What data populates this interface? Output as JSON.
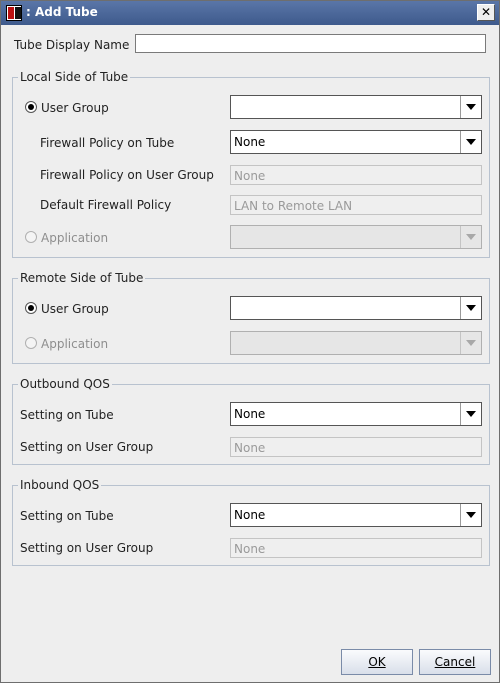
{
  "window": {
    "title": ": Add Tube",
    "close_glyph": "✕"
  },
  "display_name": {
    "label": "Tube Display Name",
    "value": ""
  },
  "local": {
    "title": "Local Side of Tube",
    "user_group_label": "User Group",
    "user_group_value": "",
    "fw_tube_label": "Firewall Policy on Tube",
    "fw_tube_value": "None",
    "fw_user_group_label": "Firewall Policy on User Group",
    "fw_user_group_value": "None",
    "default_fw_label": "Default Firewall Policy",
    "default_fw_value": "LAN to Remote LAN",
    "application_label": "Application",
    "application_value": ""
  },
  "remote": {
    "title": "Remote Side of Tube",
    "user_group_label": "User Group",
    "user_group_value": "",
    "application_label": "Application",
    "application_value": ""
  },
  "outbound": {
    "title": "Outbound QOS",
    "tube_label": "Setting on Tube",
    "tube_value": "None",
    "user_group_label": "Setting on User Group",
    "user_group_value": "None"
  },
  "inbound": {
    "title": "Inbound QOS",
    "tube_label": "Setting on Tube",
    "tube_value": "None",
    "user_group_label": "Setting on User Group",
    "user_group_value": "None"
  },
  "buttons": {
    "ok": "OK",
    "cancel": "Cancel"
  }
}
